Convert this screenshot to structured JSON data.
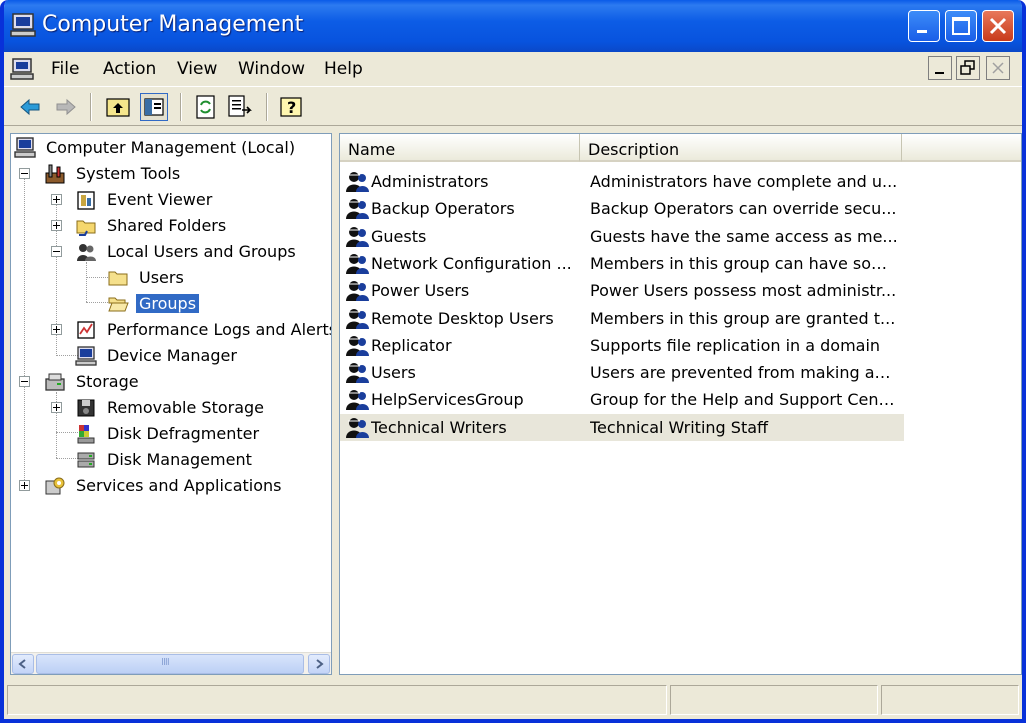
{
  "window": {
    "title": "Computer Management"
  },
  "menu": {
    "items": [
      "File",
      "Action",
      "View",
      "Window",
      "Help"
    ]
  },
  "tree": {
    "root": "Computer Management (Local)",
    "system_tools": "System Tools",
    "event_viewer": "Event Viewer",
    "shared_folders": "Shared Folders",
    "local_users_groups": "Local Users and Groups",
    "users": "Users",
    "groups": "Groups",
    "perf_logs": "Performance Logs and Alerts",
    "device_manager": "Device Manager",
    "storage": "Storage",
    "removable_storage": "Removable Storage",
    "disk_defrag": "Disk Defragmenter",
    "disk_management": "Disk Management",
    "services_apps": "Services and Applications"
  },
  "list": {
    "columns": [
      "Name",
      "Description"
    ],
    "rows": [
      {
        "name": "Administrators",
        "description": "Administrators have complete and u..."
      },
      {
        "name": "Backup Operators",
        "description": "Backup Operators can override secu..."
      },
      {
        "name": "Guests",
        "description": "Guests have the same access as me..."
      },
      {
        "name": "Network Configuration ...",
        "description": "Members in this group can have som..."
      },
      {
        "name": "Power Users",
        "description": "Power Users possess most administr..."
      },
      {
        "name": "Remote Desktop Users",
        "description": "Members in this group are granted t..."
      },
      {
        "name": "Replicator",
        "description": "Supports file replication in a domain"
      },
      {
        "name": "Users",
        "description": "Users are prevented from making ac..."
      },
      {
        "name": "HelpServicesGroup",
        "description": "Group for the Help and Support Center"
      },
      {
        "name": "Technical Writers",
        "description": "Technical Writing Staff"
      }
    ]
  },
  "icons": {
    "title": "computer-icon",
    "toolbar": [
      "back-arrow-icon",
      "forward-arrow-icon",
      "up-folder-icon",
      "show-hide-tree-icon",
      "refresh-icon",
      "export-list-icon",
      "help-icon"
    ],
    "group": "group-icon"
  },
  "colors": {
    "titlebar": "#0853DE",
    "selection": "#316AC5",
    "highlight_row": "#E8E6DA"
  }
}
